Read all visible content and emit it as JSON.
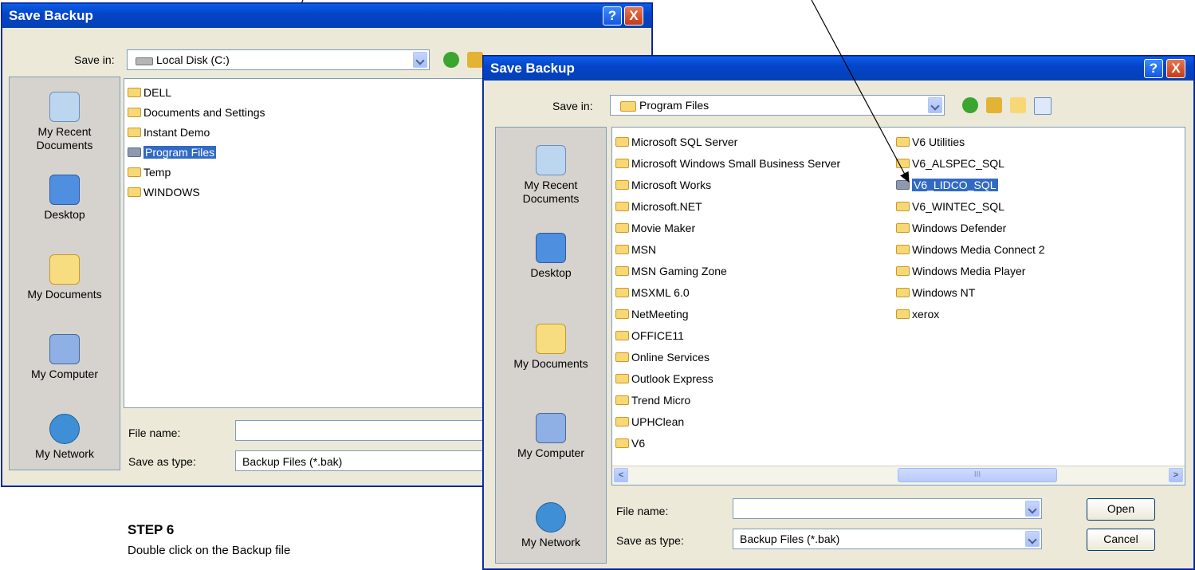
{
  "dialog_back": {
    "title": "Save Backup",
    "save_in_label": "Save in:",
    "save_in_value": "Local Disk (C:)",
    "places": [
      "My Recent Documents",
      "Desktop",
      "My Documents",
      "My Computer",
      "My Network"
    ],
    "folders": [
      "DELL",
      "Documents and Settings",
      "Instant Demo",
      "Program Files",
      "Temp",
      "WINDOWS"
    ],
    "selected_folder": "Program Files",
    "file_name_label": "File name:",
    "file_name_value": "",
    "save_as_type_label": "Save as type:",
    "save_as_type_value": "Backup Files (*.bak)"
  },
  "dialog_front": {
    "title": "Save Backup",
    "save_in_label": "Save in:",
    "save_in_value": "Program Files",
    "places": [
      "My Recent Documents",
      "Desktop",
      "My Documents",
      "My Computer",
      "My Network"
    ],
    "folders_col1": [
      "Microsoft SQL Server",
      "Microsoft Windows Small Business Server",
      "Microsoft Works",
      "Microsoft.NET",
      "Movie Maker",
      "MSN",
      "MSN Gaming Zone",
      "MSXML 6.0",
      "NetMeeting",
      "OFFICE11",
      "Online Services",
      "Outlook Express",
      "Trend Micro",
      "UPHClean",
      "V6"
    ],
    "folders_col2": [
      "V6 Utilities",
      "V6_ALSPEC_SQL",
      "V6_LIDCO_SQL",
      "V6_WINTEC_SQL",
      "Windows Defender",
      "Windows Media Connect 2",
      "Windows Media Player",
      "Windows NT",
      "xerox"
    ],
    "selected_folder": "V6_LIDCO_SQL",
    "file_name_label": "File name:",
    "file_name_value": "",
    "save_as_type_label": "Save as type:",
    "save_as_type_value": "Backup Files (*.bak)",
    "open_button": "Open",
    "cancel_button": "Cancel",
    "scrollbar_grip": "III"
  },
  "help_glyph": "?",
  "close_glyph": "X",
  "step_heading": "STEP 6",
  "step_text": "Double click on the Backup file"
}
